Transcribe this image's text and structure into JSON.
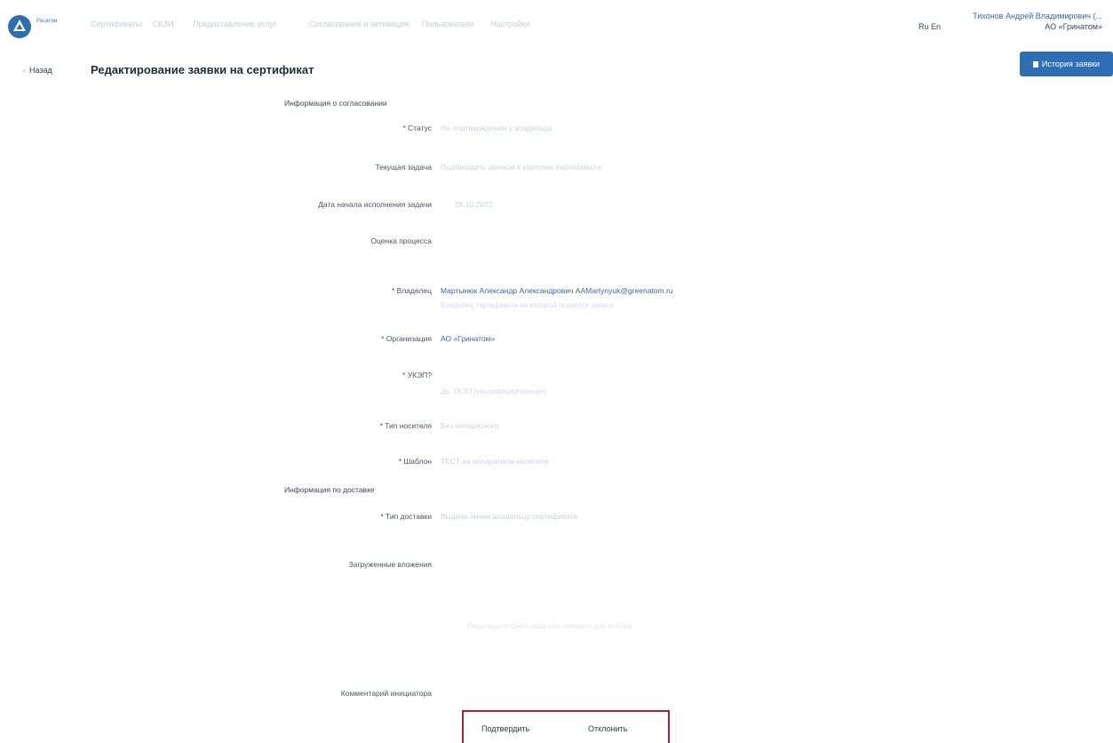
{
  "header": {
    "logo_text": "Росатом",
    "nav": [
      "Сертификаты",
      "СКЗИ",
      "Предоставление услуг",
      "Согласование и активация",
      "Пользователи",
      "Настройки"
    ],
    "lang": "Ru En",
    "user_name": "Тихонов Андрей Владимирович (...",
    "user_org": "АО «Гринатом»"
  },
  "page": {
    "back_label": "Назад",
    "title": "Редактирование заявки на сертификат",
    "history_button": "История заявки"
  },
  "sections": {
    "approval_info": "Информация о согласовании",
    "delivery_info": "Информация по доставке"
  },
  "fields": {
    "status_label": "* Статус",
    "status_value": "На подтверждении у владельца",
    "current_task_label": "Текущая задача",
    "current_task_value": "Подтвердить данные в карточке сертификата",
    "start_date_label": "Дата начала исполнения задачи",
    "start_date_value": "26.10.2022",
    "process_rating_label": "Оценка процесса",
    "owner_label": "* Владелец",
    "owner_value": "Мартынюк Александр Александрович AAMartynyuk@greenatom.ru",
    "owner_sub": "Владелец сертификата на который подается заявка",
    "org_label": "* Организация",
    "org_value": "АО «Гринатом»",
    "ukep_label": "* УКЭП?",
    "ukep_sub": "Да, УКЭП (квалифицированная)",
    "carrier_type_label": "* Тип носителя",
    "carrier_type_value": "Без аппаратного",
    "template_label": "* Шаблон",
    "template_value": "ТЕСТ на аппаратном носителе",
    "delivery_type_label": "* Тип доставки",
    "delivery_type_value": "Выдача лично владельцу сертификата",
    "attachments_label": "Загруженные вложения",
    "attachments_hint": "Перетащите файл сюда или нажмите для выбора",
    "comment_label": "Комментарий инициатора"
  },
  "actions": {
    "confirm": "Подтвердить",
    "reject": "Отклонить"
  },
  "colors": {
    "accent": "#2e6fb4",
    "highlight_box": "#a7262d",
    "link": "#3a66a8"
  }
}
